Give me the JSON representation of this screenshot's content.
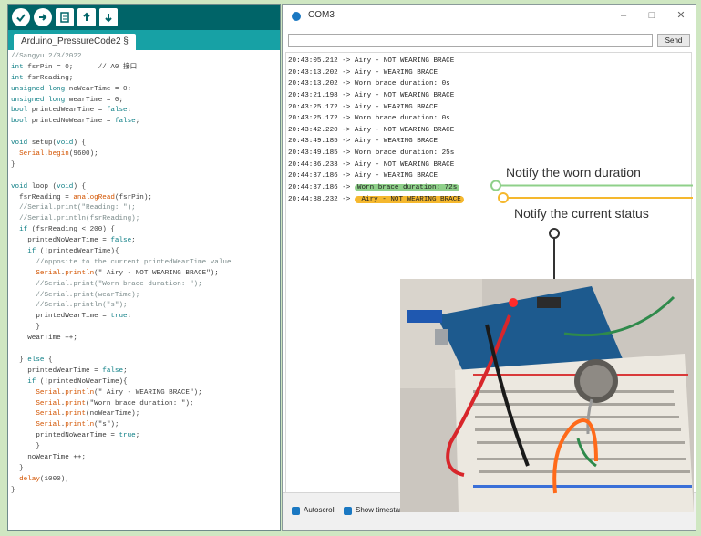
{
  "ide": {
    "tab_label": "Arduino_PressureCode2 §",
    "toolbar": [
      "verify-icon",
      "upload-icon",
      "new-icon",
      "open-icon",
      "save-icon"
    ],
    "code_lines": [
      [
        [
          "cm",
          "//Sangyu 2/3/2022"
        ]
      ],
      [
        [
          "kw",
          "int"
        ],
        [
          "tx",
          " fsrPin = 0;      // A0 接口"
        ]
      ],
      [
        [
          "kw",
          "int"
        ],
        [
          "tx",
          " fsrReading;"
        ]
      ],
      [
        [
          "kw",
          "unsigned long"
        ],
        [
          "tx",
          " noWearTime = 0;"
        ]
      ],
      [
        [
          "kw",
          "unsigned long"
        ],
        [
          "tx",
          " wearTime = 0;"
        ]
      ],
      [
        [
          "kw",
          "bool"
        ],
        [
          "tx",
          " printedWearTime = "
        ],
        [
          "kw",
          "false"
        ],
        [
          "tx",
          ";"
        ]
      ],
      [
        [
          "kw",
          "bool"
        ],
        [
          "tx",
          " printedNoWearTime = "
        ],
        [
          "kw",
          "false"
        ],
        [
          "tx",
          ";"
        ]
      ],
      [
        [
          "tx",
          ""
        ]
      ],
      [
        [
          "kw",
          "void"
        ],
        [
          "tx",
          " setup("
        ],
        [
          "kw",
          "void"
        ],
        [
          "tx",
          ") {"
        ]
      ],
      [
        [
          "tx",
          "  "
        ],
        [
          "fn",
          "Serial"
        ],
        [
          "tx",
          "."
        ],
        [
          "fn",
          "begin"
        ],
        [
          "tx",
          "(9600);"
        ]
      ],
      [
        [
          "tx",
          "}"
        ]
      ],
      [
        [
          "tx",
          ""
        ]
      ],
      [
        [
          "kw",
          "void"
        ],
        [
          "tx",
          " loop ("
        ],
        [
          "kw",
          "void"
        ],
        [
          "tx",
          ") {"
        ]
      ],
      [
        [
          "tx",
          "  fsrReading = "
        ],
        [
          "fn",
          "analogRead"
        ],
        [
          "tx",
          "(fsrPin);"
        ]
      ],
      [
        [
          "cm",
          "  //Serial.print(\"Reading: \");"
        ]
      ],
      [
        [
          "cm",
          "  //Serial.println(fsrReading);"
        ]
      ],
      [
        [
          "tx",
          "  "
        ],
        [
          "kw",
          "if"
        ],
        [
          "tx",
          " (fsrReading < 200) {"
        ]
      ],
      [
        [
          "tx",
          "    printedNoWearTime = "
        ],
        [
          "kw",
          "false"
        ],
        [
          "tx",
          ";"
        ]
      ],
      [
        [
          "tx",
          "    "
        ],
        [
          "kw",
          "if"
        ],
        [
          "tx",
          " (!printedWearTime){"
        ]
      ],
      [
        [
          "cm",
          "      //opposite to the current printedWearTime value"
        ]
      ],
      [
        [
          "tx",
          "      "
        ],
        [
          "fn",
          "Serial"
        ],
        [
          "tx",
          "."
        ],
        [
          "fn",
          "println"
        ],
        [
          "tx",
          "(\" Airy - NOT WEARING BRACE\");"
        ]
      ],
      [
        [
          "cm",
          "      //Serial.print(\"Worn brace duration: \");"
        ]
      ],
      [
        [
          "cm",
          "      //Serial.print(wearTime);"
        ]
      ],
      [
        [
          "cm",
          "      //Serial.println(\"s\");"
        ]
      ],
      [
        [
          "tx",
          "      printedWearTime = "
        ],
        [
          "kw",
          "true"
        ],
        [
          "tx",
          ";"
        ]
      ],
      [
        [
          "tx",
          "      }"
        ]
      ],
      [
        [
          "tx",
          "    wearTime ++;"
        ]
      ],
      [
        [
          "tx",
          ""
        ]
      ],
      [
        [
          "tx",
          "  } "
        ],
        [
          "kw",
          "else"
        ],
        [
          "tx",
          " {"
        ]
      ],
      [
        [
          "tx",
          "    printedWearTime = "
        ],
        [
          "kw",
          "false"
        ],
        [
          "tx",
          ";"
        ]
      ],
      [
        [
          "tx",
          "    "
        ],
        [
          "kw",
          "if"
        ],
        [
          "tx",
          " (!printedNoWearTime){"
        ]
      ],
      [
        [
          "tx",
          "      "
        ],
        [
          "fn",
          "Serial"
        ],
        [
          "tx",
          "."
        ],
        [
          "fn",
          "println"
        ],
        [
          "tx",
          "(\" Airy - WEARING BRACE\");"
        ]
      ],
      [
        [
          "tx",
          "      "
        ],
        [
          "fn",
          "Serial"
        ],
        [
          "tx",
          "."
        ],
        [
          "fn",
          "print"
        ],
        [
          "tx",
          "(\"Worn brace duration: \");"
        ]
      ],
      [
        [
          "tx",
          "      "
        ],
        [
          "fn",
          "Serial"
        ],
        [
          "tx",
          "."
        ],
        [
          "fn",
          "print"
        ],
        [
          "tx",
          "(noWearTime);"
        ]
      ],
      [
        [
          "tx",
          "      "
        ],
        [
          "fn",
          "Serial"
        ],
        [
          "tx",
          "."
        ],
        [
          "fn",
          "println"
        ],
        [
          "tx",
          "(\"s\");"
        ]
      ],
      [
        [
          "tx",
          "      printedNoWearTime = "
        ],
        [
          "kw",
          "true"
        ],
        [
          "tx",
          ";"
        ]
      ],
      [
        [
          "tx",
          "      }"
        ]
      ],
      [
        [
          "tx",
          "    noWearTime ++;"
        ]
      ],
      [
        [
          "tx",
          "  }"
        ]
      ],
      [
        [
          "tx",
          "  "
        ],
        [
          "fn",
          "delay"
        ],
        [
          "tx",
          "(1000);"
        ]
      ],
      [
        [
          "tx",
          "}"
        ]
      ]
    ]
  },
  "serial": {
    "title": "COM3",
    "send_label": "Send",
    "output": [
      {
        "text": "20:43:05.212 -> Airy - NOT WEARING BRACE",
        "hl": ""
      },
      {
        "text": "20:43:13.202 -> Airy - WEARING BRACE",
        "hl": ""
      },
      {
        "text": "20:43:13.202 -> Worn brace duration: 0s",
        "hl": ""
      },
      {
        "text": "20:43:21.198 -> Airy - NOT WEARING BRACE",
        "hl": ""
      },
      {
        "text": "20:43:25.172 -> Airy - WEARING BRACE",
        "hl": ""
      },
      {
        "text": "20:43:25.172 -> Worn brace duration: 0s",
        "hl": ""
      },
      {
        "text": "20:43:42.220 -> Airy - NOT WEARING BRACE",
        "hl": ""
      },
      {
        "text": "20:43:49.185 -> Airy - WEARING BRACE",
        "hl": ""
      },
      {
        "text": "20:43:49.185 -> Worn brace duration: 25s",
        "hl": ""
      },
      {
        "text": "20:44:36.233 -> Airy - NOT WEARING BRACE",
        "hl": ""
      },
      {
        "text": "20:44:37.186 -> Airy - WEARING BRACE",
        "hl": ""
      },
      {
        "text": "20:44:37.186 -> ",
        "hl": "green",
        "hltext": "Worn brace duration: 72s"
      },
      {
        "text": "20:44:38.232 -> ",
        "hl": "yellow",
        "hltext": " Airy - NOT WEARING BRACE"
      }
    ],
    "autoscroll_label": "Autoscroll",
    "timestamp_label": "Show timestan"
  },
  "annotations": {
    "worn_duration": "Notify the worn duration",
    "current_status": "Notify the current status"
  },
  "colors": {
    "background": "#cfe7c2",
    "ide_toolbar": "#006468",
    "ide_tabs": "#17a1a5",
    "highlight_green": "#8fd08a",
    "highlight_yellow": "#f5b82e"
  }
}
